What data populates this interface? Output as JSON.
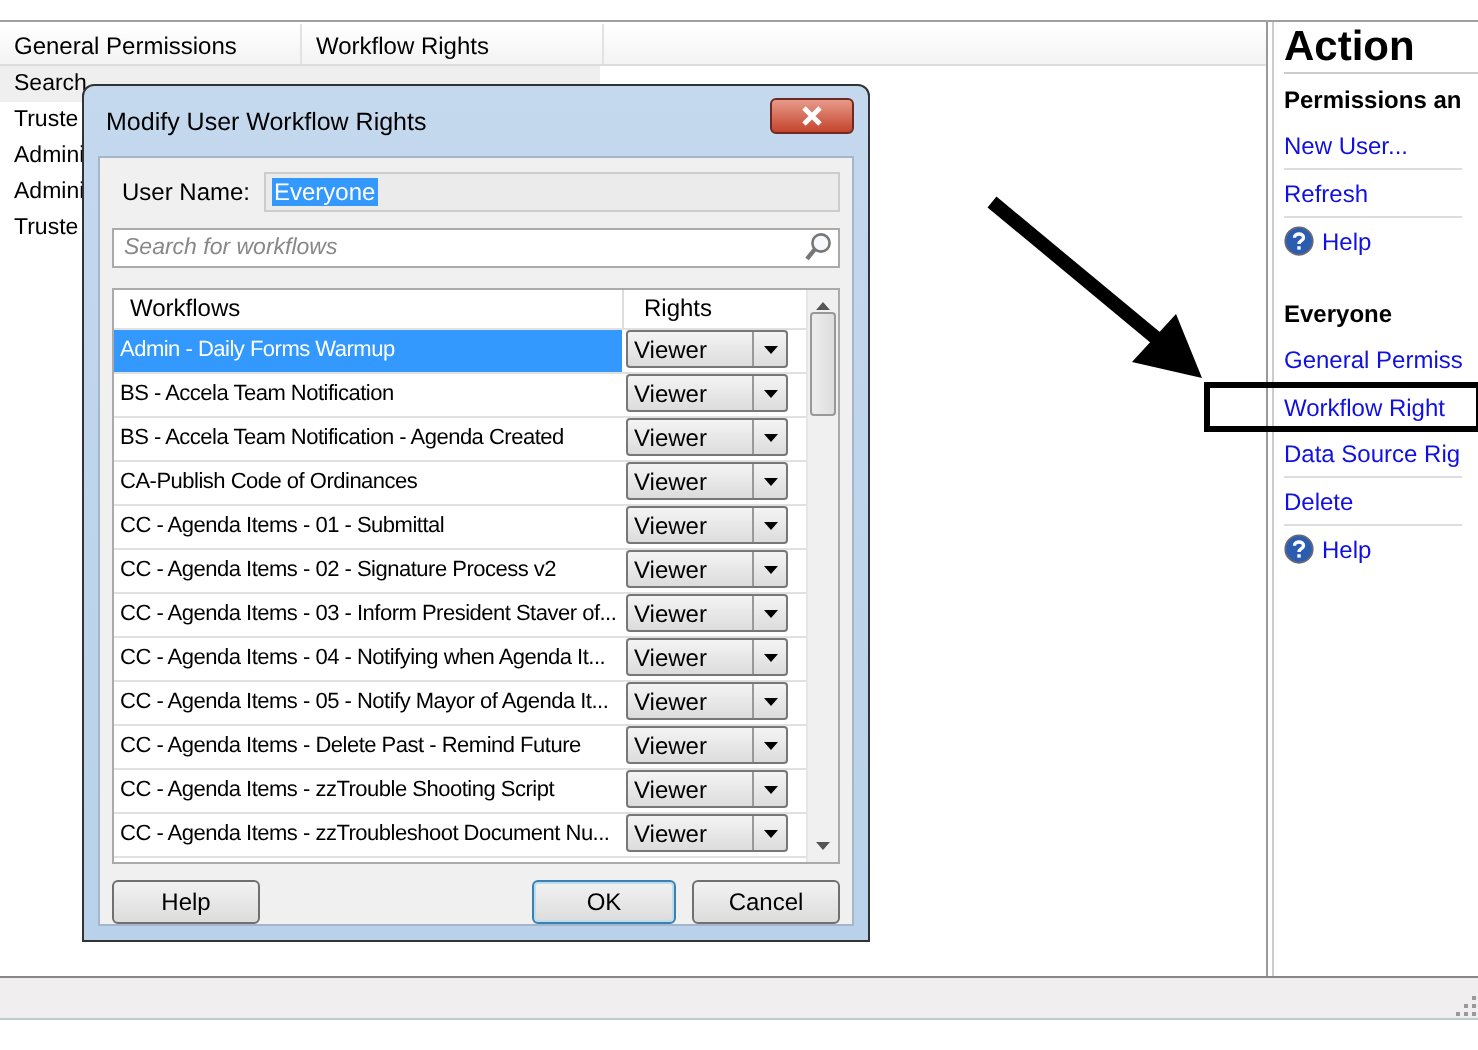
{
  "permissions_list": {
    "columns": [
      "General Permissions",
      "Workflow Rights"
    ],
    "rows": [
      "Search",
      "Truste",
      "Admini",
      "Admini",
      "Truste"
    ]
  },
  "dialog": {
    "title": "Modify User Workflow Rights",
    "user_name_label": "User Name:",
    "user_name": "Everyone",
    "search": {
      "placeholder": "Search for workflows"
    },
    "grid": {
      "columns": [
        "Workflows",
        "Rights"
      ],
      "rows": [
        {
          "workflow": "Admin - Daily Forms Warmup",
          "rights": "Viewer",
          "selected": true
        },
        {
          "workflow": "BS - Accela Team Notification",
          "rights": "Viewer",
          "selected": false
        },
        {
          "workflow": "BS - Accela Team Notification - Agenda Created",
          "rights": "Viewer",
          "selected": false
        },
        {
          "workflow": "CA-Publish Code of Ordinances",
          "rights": "Viewer",
          "selected": false
        },
        {
          "workflow": "CC - Agenda Items - 01 - Submittal",
          "rights": "Viewer",
          "selected": false
        },
        {
          "workflow": "CC - Agenda Items - 02 - Signature Process v2",
          "rights": "Viewer",
          "selected": false
        },
        {
          "workflow": "CC - Agenda Items - 03 - Inform President Staver of...",
          "rights": "Viewer",
          "selected": false
        },
        {
          "workflow": "CC - Agenda Items - 04 - Notifying when Agenda It...",
          "rights": "Viewer",
          "selected": false
        },
        {
          "workflow": "CC - Agenda Items - 05 - Notify Mayor of Agenda It...",
          "rights": "Viewer",
          "selected": false
        },
        {
          "workflow": "CC - Agenda Items - Delete Past - Remind Future",
          "rights": "Viewer",
          "selected": false
        },
        {
          "workflow": "CC - Agenda Items - zzTrouble Shooting Script",
          "rights": "Viewer",
          "selected": false
        },
        {
          "workflow": "CC - Agenda Items - zzTroubleshoot Document Nu...",
          "rights": "Viewer",
          "selected": false
        }
      ]
    },
    "buttons": [
      {
        "label": "Help",
        "kind": "help"
      },
      {
        "label": "OK",
        "kind": "default"
      },
      {
        "label": "Cancel",
        "kind": "cancel"
      }
    ]
  },
  "action_pane": {
    "title": "Action",
    "sections": [
      {
        "heading": "Permissions an",
        "items": [
          {
            "label": "New User...",
            "kind": "link",
            "highlighted": false
          },
          {
            "label": "Refresh",
            "kind": "link",
            "highlighted": false
          },
          {
            "label": "Help",
            "kind": "help",
            "highlighted": false
          }
        ]
      },
      {
        "heading": "Everyone",
        "items": [
          {
            "label": "General Permiss",
            "kind": "link",
            "highlighted": false
          },
          {
            "label": "Workflow Right",
            "kind": "link",
            "highlighted": true
          },
          {
            "label": "Data Source Rig",
            "kind": "link",
            "highlighted": false
          },
          {
            "label": "Delete",
            "kind": "link",
            "highlighted": false
          },
          {
            "label": "Help",
            "kind": "help",
            "highlighted": false
          }
        ]
      }
    ]
  }
}
